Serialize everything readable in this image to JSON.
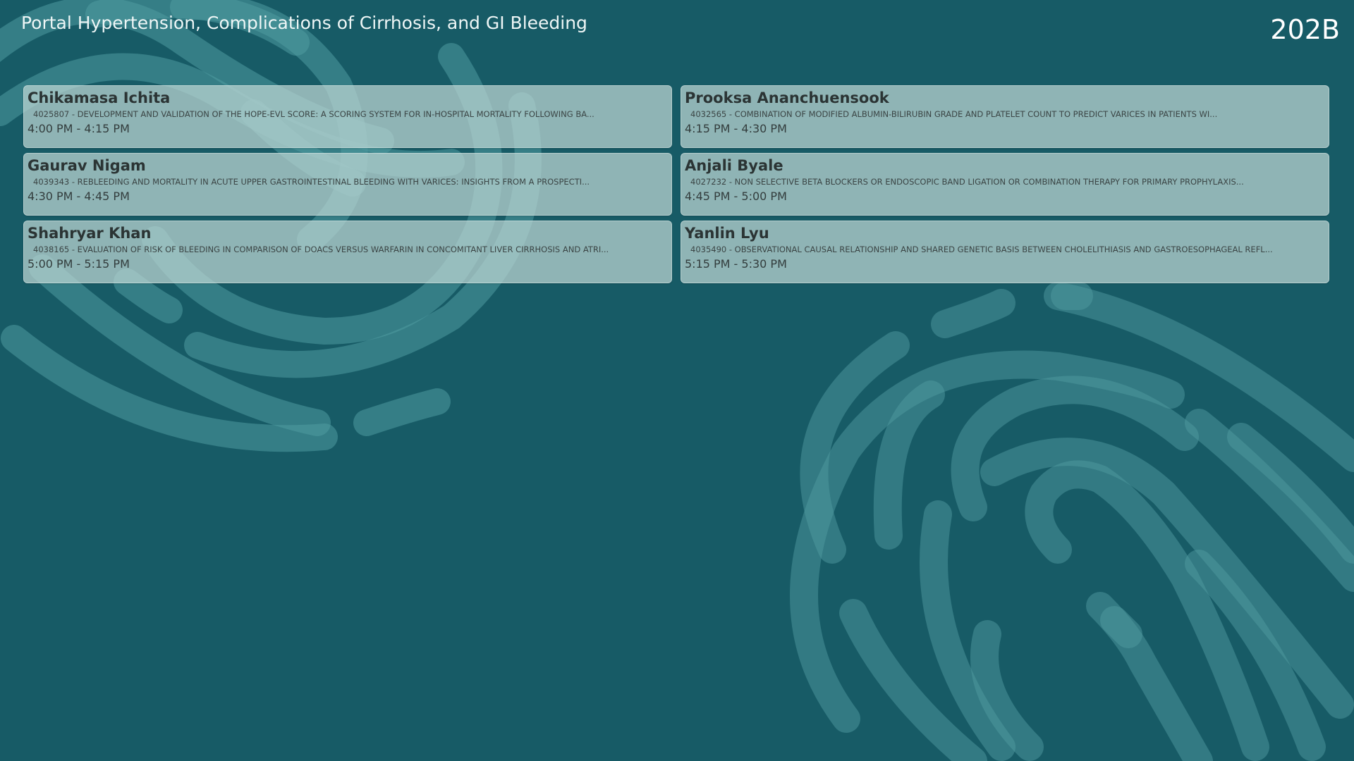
{
  "header": {
    "session_title": "Portal Hypertension, Complications of Cirrhosis, and GI Bleeding",
    "room": "202B"
  },
  "presentations": [
    {
      "speaker": "Chikamasa Ichita",
      "abstract": "4025807 - DEVELOPMENT AND VALIDATION OF THE HOPE-EVL SCORE: A SCORING SYSTEM FOR IN-HOSPITAL MORTALITY FOLLOWING BA...",
      "time": "4:00 PM - 4:15 PM"
    },
    {
      "speaker": "Prooksa Ananchuensook",
      "abstract": "4032565 - COMBINATION OF MODIFIED ALBUMIN-BILIRUBIN GRADE AND PLATELET COUNT TO PREDICT VARICES IN PATIENTS WI...",
      "time": "4:15 PM - 4:30 PM"
    },
    {
      "speaker": "Gaurav Nigam",
      "abstract": "4039343 - REBLEEDING AND MORTALITY IN ACUTE UPPER GASTROINTESTINAL BLEEDING WITH VARICES: INSIGHTS FROM A PROSPECTI...",
      "time": "4:30 PM - 4:45 PM"
    },
    {
      "speaker": "Anjali Byale",
      "abstract": "4027232 - NON SELECTIVE BETA BLOCKERS OR ENDOSCOPIC BAND LIGATION OR COMBINATION THERAPY FOR PRIMARY PROPHYLAXIS...",
      "time": "4:45 PM - 5:00 PM"
    },
    {
      "speaker": "Shahryar Khan",
      "abstract": "4038165 - EVALUATION OF RISK OF BLEEDING IN COMPARISON OF DOACS VERSUS WARFARIN IN CONCOMITANT LIVER CIRRHOSIS AND ATRI...",
      "time": "5:00 PM - 5:15 PM"
    },
    {
      "speaker": "Yanlin Lyu",
      "abstract": "4035490 - OBSERVATIONAL CAUSAL RELATIONSHIP AND SHARED GENETIC BASIS BETWEEN CHOLELITHIASIS AND GASTROESOPHAGEAL REFL...",
      "time": "5:15 PM - 5:30 PM"
    }
  ],
  "colors": {
    "background": "#175b66",
    "card": "#bed7d4",
    "pattern": "#4f9aa0"
  }
}
